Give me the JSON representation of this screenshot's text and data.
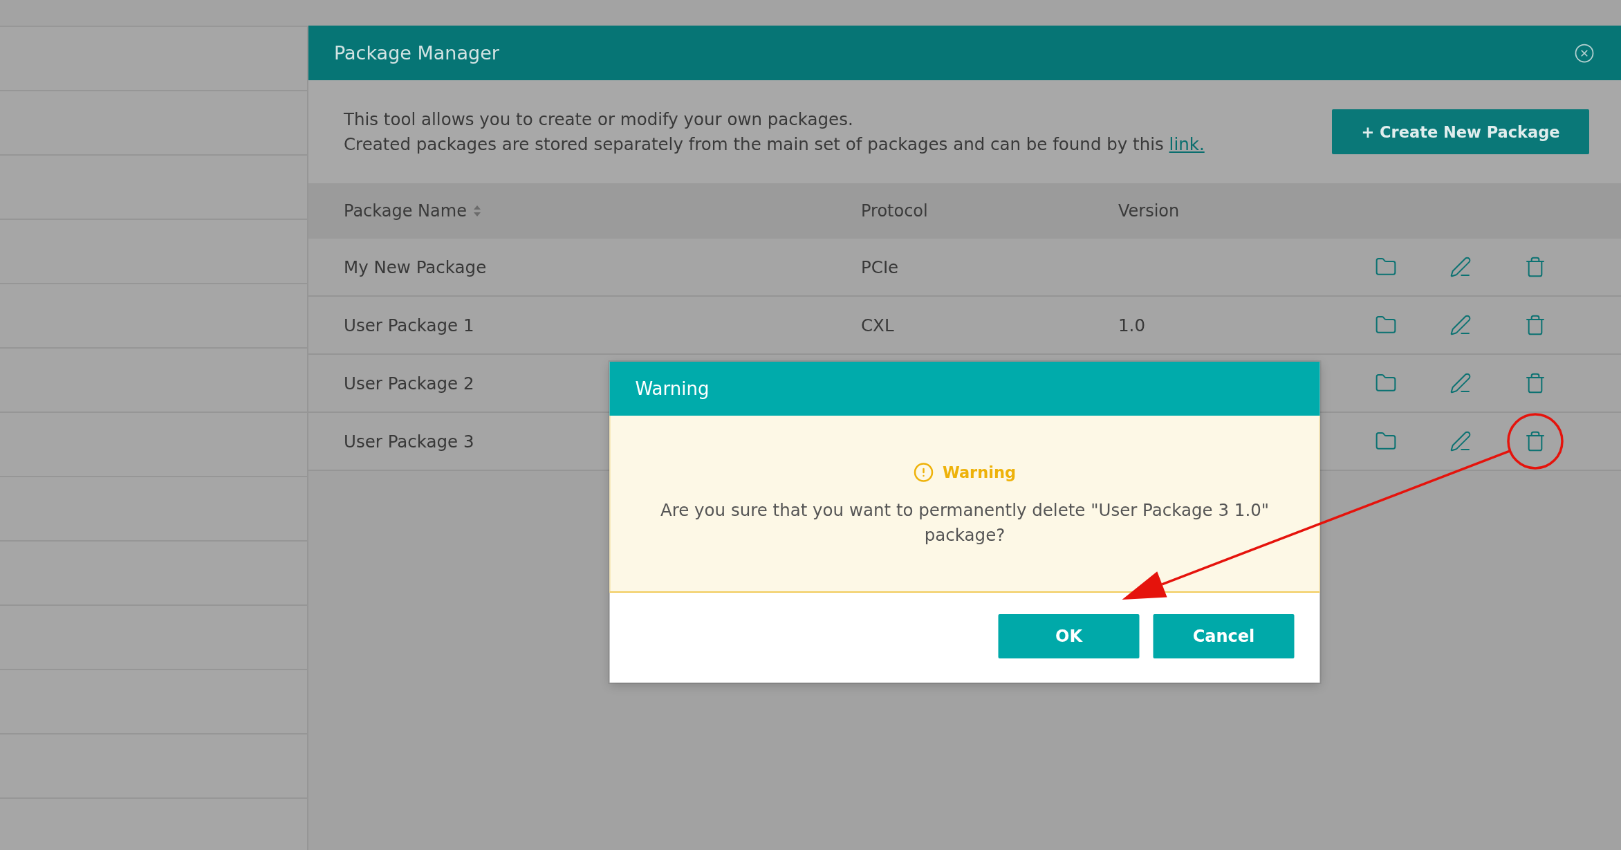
{
  "window": {
    "title": "Package Manager"
  },
  "intro": {
    "lines": [
      "This tool allows you to create or modify your own packages.",
      "Created packages are stored separately from the main set of packages and can be found by this"
    ],
    "link": "link."
  },
  "create_button": {
    "label": "+ Create New Package"
  },
  "table": {
    "columns": [
      {
        "label": "Package Name",
        "sortable": true
      },
      {
        "label": "Protocol",
        "sortable": false
      },
      {
        "label": "Version",
        "sortable": false
      }
    ],
    "rows": [
      {
        "name": "My New Package",
        "protocol": "PCIe",
        "circled": false
      },
      {
        "name": "User Package 1",
        "protocol": "CXL",
        "version": "1.0",
        "circled": false
      },
      {
        "name": "User Package 2",
        "circled": false
      },
      {
        "name": "User Package 3",
        "circled": true
      }
    ]
  },
  "dialog": {
    "title": "Warning",
    "heading": "Warning",
    "message": "Are you sure that you want to permanently delete \"User Package 3 1.0\" package?",
    "buttons": [
      {
        "label": "OK"
      },
      {
        "label": "Cancel"
      }
    ]
  }
}
